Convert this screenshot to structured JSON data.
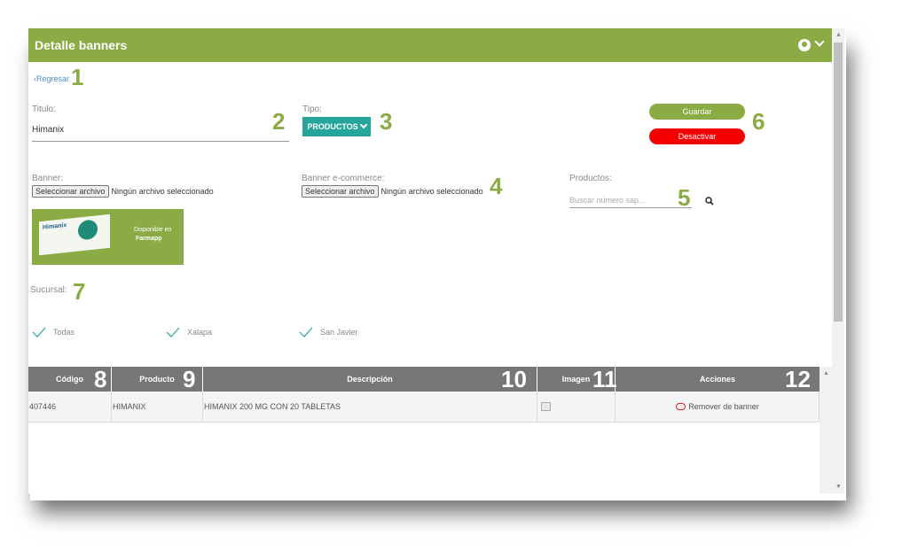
{
  "header": {
    "title": "Detalle banners"
  },
  "nav": {
    "back_label": "Regresar"
  },
  "form": {
    "title_label": "Titulo:",
    "title_value": "Himanix",
    "type_label": "Tipo:",
    "type_value": "PRODUCTOS",
    "banner_label": "Banner:",
    "banner_ecommerce_label": "Banner e-commerce:",
    "file_button": "Seleccionar archivo",
    "file_none": "Ningún archivo seleccionado",
    "products_label": "Productos:",
    "search_placeholder": "Buscar número sap...",
    "save_label": "Guardar",
    "deactivate_label": "Desactivar",
    "branch_label": "Sucursal:"
  },
  "banner_image": {
    "text_line1": "Disponible en",
    "text_line2": "Farmapp",
    "brand": "Himanix"
  },
  "branches": [
    "Todas",
    "Xalapa",
    "San Javier"
  ],
  "markers": [
    "1",
    "2",
    "3",
    "4",
    "5",
    "6",
    "7",
    "8",
    "9",
    "10",
    "11",
    "12"
  ],
  "table": {
    "headers": [
      "Código",
      "Producto",
      "Descripción",
      "Imagen",
      "Acciones"
    ],
    "rows": [
      {
        "code": "407446",
        "product": "HIMANIX",
        "description": "HIMANIX 200 MG CON 20 TABLETAS",
        "action": "Remover de banner"
      }
    ]
  },
  "colors": {
    "accent": "#8bab45",
    "teal": "#26a69a",
    "danger": "#f40000",
    "table_header": "#777777"
  }
}
